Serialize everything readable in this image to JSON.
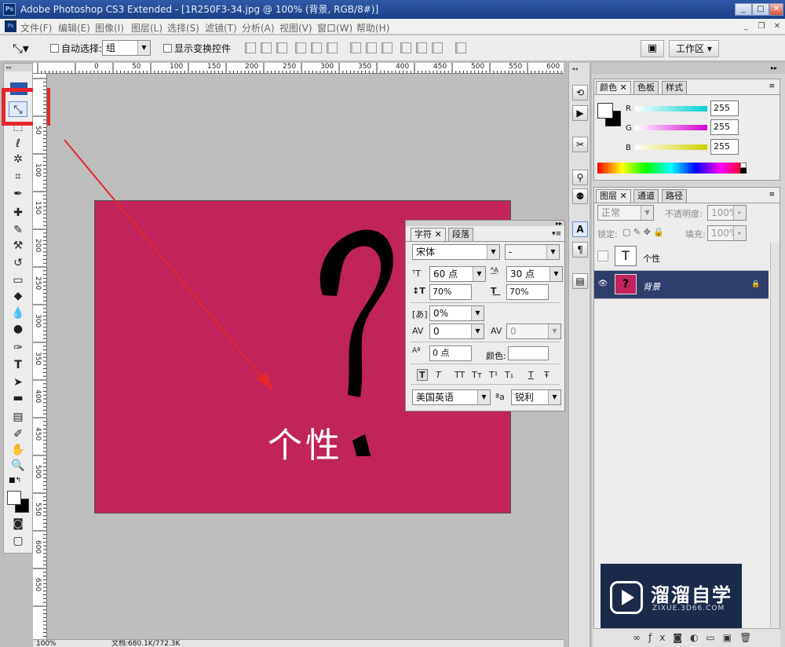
{
  "window": {
    "title": "Adobe Photoshop CS3 Extended - [1R250F3-34.jpg @ 100% (背景, RGB/8#)]",
    "min": "_",
    "max": "□",
    "close": "✕"
  },
  "menu": [
    "文件(F)",
    "编辑(E)",
    "图像(I)",
    "图层(L)",
    "选择(S)",
    "滤镜(T)",
    "分析(A)",
    "视图(V)",
    "窗口(W)",
    "帮助(H)"
  ],
  "options": {
    "auto_select_label": "自动选择:",
    "auto_select_value": "组",
    "show_transform_label": "显示变换控件",
    "workspace_label": "工作区"
  },
  "rulers": {
    "h_ticks": [
      "0",
      "50",
      "100",
      "150",
      "200",
      "250",
      "300",
      "350",
      "400",
      "450",
      "500",
      "550",
      "600",
      "650"
    ],
    "v_ticks": [
      "50",
      "100",
      "150",
      "200",
      "250",
      "300",
      "350",
      "400",
      "450",
      "500",
      "550",
      "600",
      "650"
    ]
  },
  "canvas": {
    "text": "个性",
    "bg_color": "#c1235b"
  },
  "status": {
    "zoom": "100%",
    "doc": "文档:680.1K/772.3K"
  },
  "character": {
    "tabs": [
      "字符",
      "段落"
    ],
    "font_family": "宋体",
    "font_style": "-",
    "size": "60 点",
    "leading": "30 点",
    "v_scale": "70%",
    "h_scale": "70%",
    "tracking_ratio": "0%",
    "kerning": "0",
    "tracking": "0",
    "baseline": "0 点",
    "color_label": "颜色:",
    "style_buttons": [
      "T",
      "T",
      "TT",
      "Tт",
      "T¹",
      "T₁",
      "T",
      "Ŧ"
    ],
    "language": "美国英语",
    "aa_label": "ªa",
    "antialias": "锐利"
  },
  "color_panel": {
    "tabs": [
      "颜色",
      "色板",
      "样式"
    ],
    "channels": [
      {
        "name": "R",
        "value": "255",
        "color": "#00d0d0"
      },
      {
        "name": "G",
        "value": "255",
        "color": "#d000d0"
      },
      {
        "name": "B",
        "value": "255",
        "color": "#d0d000"
      }
    ]
  },
  "layers_panel": {
    "tabs": [
      "图层",
      "通道",
      "路径"
    ],
    "blend_mode": "正常",
    "opacity_label": "不透明度:",
    "opacity": "100%",
    "lock_label": "锁定:",
    "fill_label": "填充:",
    "fill": "100%",
    "layers": [
      {
        "name": "个性",
        "thumb": "T"
      },
      {
        "name": "背景",
        "thumb": "?"
      }
    ]
  },
  "watermark": {
    "brand": "溜溜自学",
    "url": "ZIXUE.3D66.COM"
  }
}
